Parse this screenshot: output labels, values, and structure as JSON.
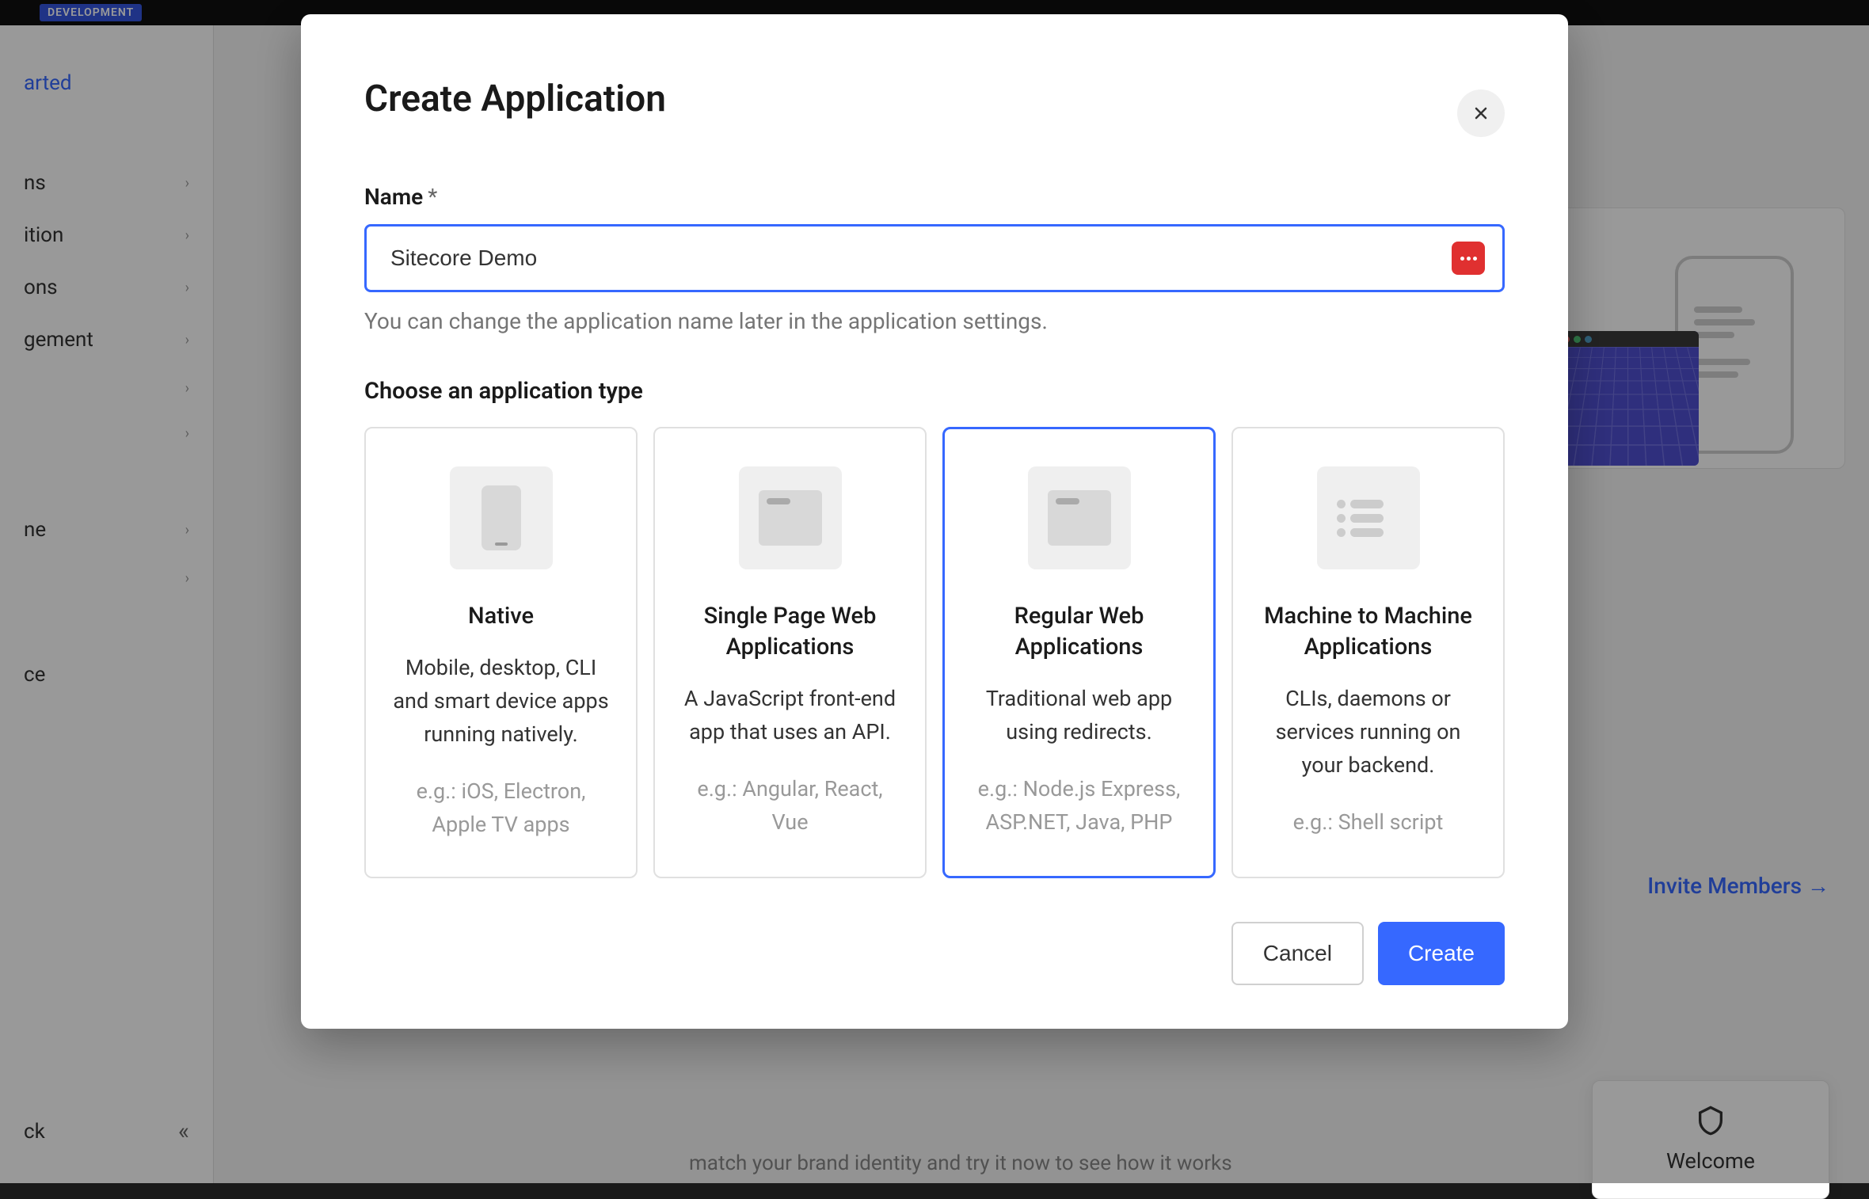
{
  "bg": {
    "dev_badge": "DEVELOPMENT",
    "sidebar": {
      "started": "arted",
      "items": [
        "ns",
        "ition",
        "ons",
        "gement",
        "",
        "",
        "ne",
        ""
      ],
      "marketplace": "ce",
      "footer": "ck"
    },
    "invite_link": "Invite Members →",
    "welcome": "Welcome",
    "bottom_text": "match your brand identity and try it now to see how it works"
  },
  "modal": {
    "title": "Create Application",
    "name_label": "Name",
    "required": "*",
    "name_value": "Sitecore Demo",
    "name_hint": "You can change the application name later in the application settings.",
    "type_label": "Choose an application type",
    "types": [
      {
        "title": "Native",
        "desc": "Mobile, desktop, CLI and smart device apps running natively.",
        "example": "e.g.: iOS, Electron, Apple TV apps"
      },
      {
        "title": "Single Page Web Applications",
        "desc": "A JavaScript front-end app that uses an API.",
        "example": "e.g.: Angular, React, Vue"
      },
      {
        "title": "Regular Web Applications",
        "desc": "Traditional web app using redirects.",
        "example": "e.g.: Node.js Express, ASP.NET, Java, PHP"
      },
      {
        "title": "Machine to Machine Applications",
        "desc": "CLIs, daemons or services running on your backend.",
        "example": "e.g.: Shell script"
      }
    ],
    "cancel": "Cancel",
    "create": "Create"
  }
}
